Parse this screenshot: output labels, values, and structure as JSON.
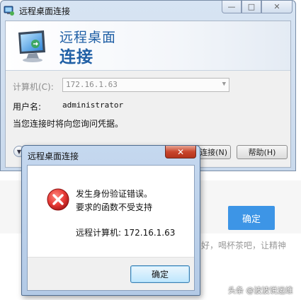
{
  "background": {
    "confirm_label": "确定",
    "partial_text": "好，喝杯茶吧，让精神",
    "watermark": "头条 @波波说运维"
  },
  "main_window": {
    "title": "远程桌面连接",
    "controls": {
      "minimize": "—",
      "maximize": "□",
      "close": "✕"
    },
    "banner_line1": "远程桌面",
    "banner_line2": "连接",
    "computer_label": "计算机(C):",
    "computer_value": "172.16.1.63",
    "username_label": "用户名:",
    "username_value": "administrator",
    "credential_note": "当您连接时将向您询问凭据。",
    "connect_label": "连接(N)",
    "help_label": "帮助(H)",
    "icons": {
      "app": "remote-desktop-icon",
      "options": "chevron-down-icon"
    }
  },
  "error_dialog": {
    "title": "远程桌面连接",
    "close": "✕",
    "message_line1": "发生身份验证错误。",
    "message_line2": "要求的函数不受支持",
    "remote_label": "远程计算机: 172.16.1.63",
    "ok_label": "确定",
    "icon": "error-icon",
    "colors": {
      "error": "#d32f2f",
      "accent": "#3d95e6"
    }
  }
}
